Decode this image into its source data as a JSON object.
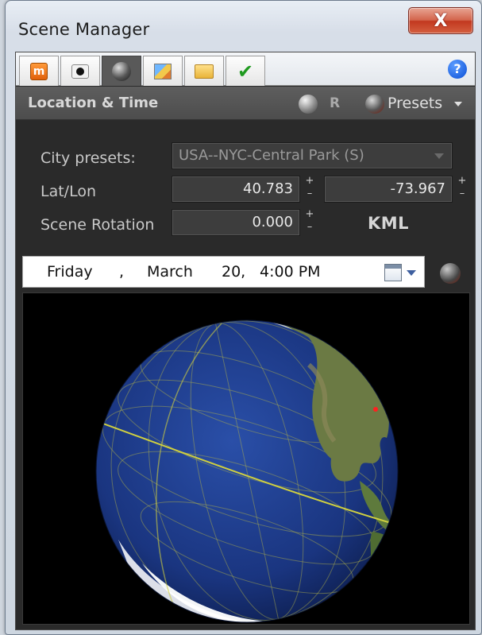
{
  "window": {
    "title": "Scene Manager",
    "close_label": "X"
  },
  "tabs": [
    {
      "name": "materials",
      "icon": "materials-icon",
      "active": false
    },
    {
      "name": "camera",
      "icon": "camera-icon",
      "active": false
    },
    {
      "name": "location-time",
      "icon": "globe-icon",
      "active": true
    },
    {
      "name": "images",
      "icon": "picture-icon",
      "active": false
    },
    {
      "name": "folder",
      "icon": "folder-icon",
      "active": false
    },
    {
      "name": "apply",
      "icon": "checkmark-icon",
      "active": false
    }
  ],
  "help_label": "?",
  "section": {
    "title": "Location & Time",
    "r_label": "R",
    "presets_label": "Presets"
  },
  "form": {
    "city_presets_label": "City presets:",
    "city_presets_value": "USA--NYC-Central Park (S)",
    "latlon_label": "Lat/Lon",
    "lat_value": "40.783",
    "lon_value": "-73.967",
    "rotation_label": "Scene Rotation",
    "rotation_value": "0.000",
    "spin_plus": "+",
    "spin_minus": "–",
    "kml_label": "KML"
  },
  "datetime": {
    "weekday": "Friday",
    "sep": ",",
    "month": "March",
    "day": "20,",
    "time": "4:00 PM"
  },
  "colors": {
    "panel_bg": "#2a2a2a",
    "ocean": "#1a3580",
    "land": "#6b7a44",
    "graticule": "#b5b548",
    "terminator": "#cfcf40",
    "location_marker": "#ff2020"
  }
}
